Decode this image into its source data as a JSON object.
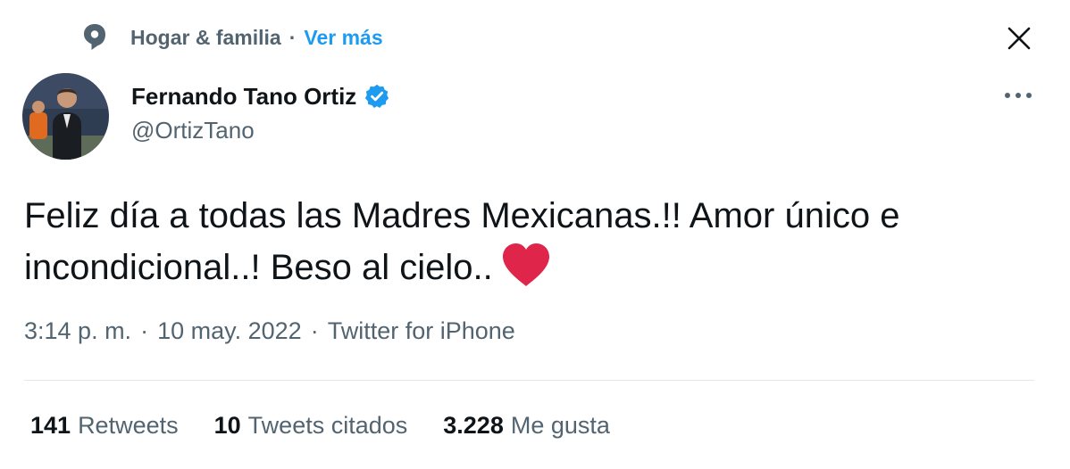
{
  "context": {
    "icon": "topic-icon",
    "topic": "Hogar & familia",
    "separator": "·",
    "more": "Ver más"
  },
  "close_icon": "close-icon",
  "author": {
    "name": "Fernando Tano Ortiz",
    "verified_icon": "verified-badge-icon",
    "handle": "@OrtizTano"
  },
  "more_icon": "more-horizontal-icon",
  "tweet": {
    "text": "Feliz día a todas las Madres Mexicanas.!! Amor único e incondicional..! Beso al cielo..",
    "emoji": "heart-emoji"
  },
  "meta": {
    "time": "3:14 p. m.",
    "sep1": "·",
    "date": "10 may. 2022",
    "sep2": "·",
    "source": "Twitter for iPhone"
  },
  "stats": [
    {
      "count": "141",
      "label": "Retweets"
    },
    {
      "count": "10",
      "label": "Tweets citados"
    },
    {
      "count": "3.228",
      "label": "Me gusta"
    }
  ],
  "colors": {
    "accent": "#1d9bf0",
    "secondary_text": "#536471",
    "primary_text": "#0f1419",
    "heart": "#e0254a"
  }
}
